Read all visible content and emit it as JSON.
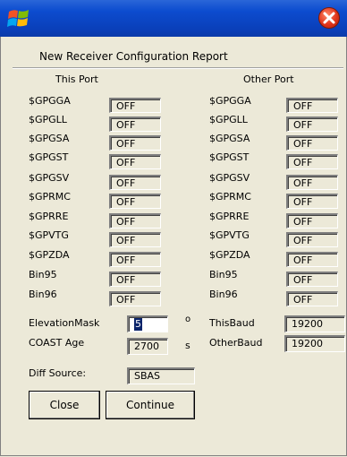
{
  "window": {
    "logo_icon": "windows-flag-icon",
    "close_icon": "close-icon",
    "title_bar_color": "#0c4ccf",
    "close_color": "#e0341a"
  },
  "report_title": "New Receiver  Configuration Report",
  "this_port": {
    "header": "This Port",
    "rows": [
      {
        "label": "$GPGGA",
        "value": "OFF"
      },
      {
        "label": "$GPGLL",
        "value": "OFF"
      },
      {
        "label": "$GPGSA",
        "value": "OFF"
      },
      {
        "label": "$GPGST",
        "value": "OFF"
      },
      {
        "label": "$GPGSV",
        "value": "OFF"
      },
      {
        "label": "$GPRMC",
        "value": "OFF"
      },
      {
        "label": "$GPRRE",
        "value": "OFF"
      },
      {
        "label": "$GPVTG",
        "value": "OFF"
      },
      {
        "label": "$GPZDA",
        "value": "OFF"
      },
      {
        "label": "Bin95",
        "value": "OFF"
      },
      {
        "label": "Bin96",
        "value": "OFF"
      }
    ]
  },
  "other_port": {
    "header": "Other Port",
    "rows": [
      {
        "label": "$GPGGA",
        "value": "OFF"
      },
      {
        "label": "$GPGLL",
        "value": "OFF"
      },
      {
        "label": "$GPGSA",
        "value": "OFF"
      },
      {
        "label": "$GPGST",
        "value": "OFF"
      },
      {
        "label": "$GPGSV",
        "value": "OFF"
      },
      {
        "label": "$GPRMC",
        "value": "OFF"
      },
      {
        "label": "$GPRRE",
        "value": "OFF"
      },
      {
        "label": "$GPVTG",
        "value": "OFF"
      },
      {
        "label": "$GPZDA",
        "value": "OFF"
      },
      {
        "label": "Bin95",
        "value": "OFF"
      },
      {
        "label": "Bin96",
        "value": "OFF"
      }
    ]
  },
  "settings": {
    "elevation_mask_label": "ElevationMask",
    "elevation_mask_value": "5",
    "elevation_mask_unit": "o",
    "coast_age_label": "COAST Age",
    "coast_age_value": "2700",
    "coast_age_unit": "s",
    "this_baud_label": "ThisBaud",
    "this_baud_value": "19200",
    "other_baud_label": "OtherBaud",
    "other_baud_value": "19200",
    "diff_source_label": "Diff Source:",
    "diff_source_value": "SBAS"
  },
  "buttons": {
    "close": "Close",
    "continue": "Continue"
  }
}
